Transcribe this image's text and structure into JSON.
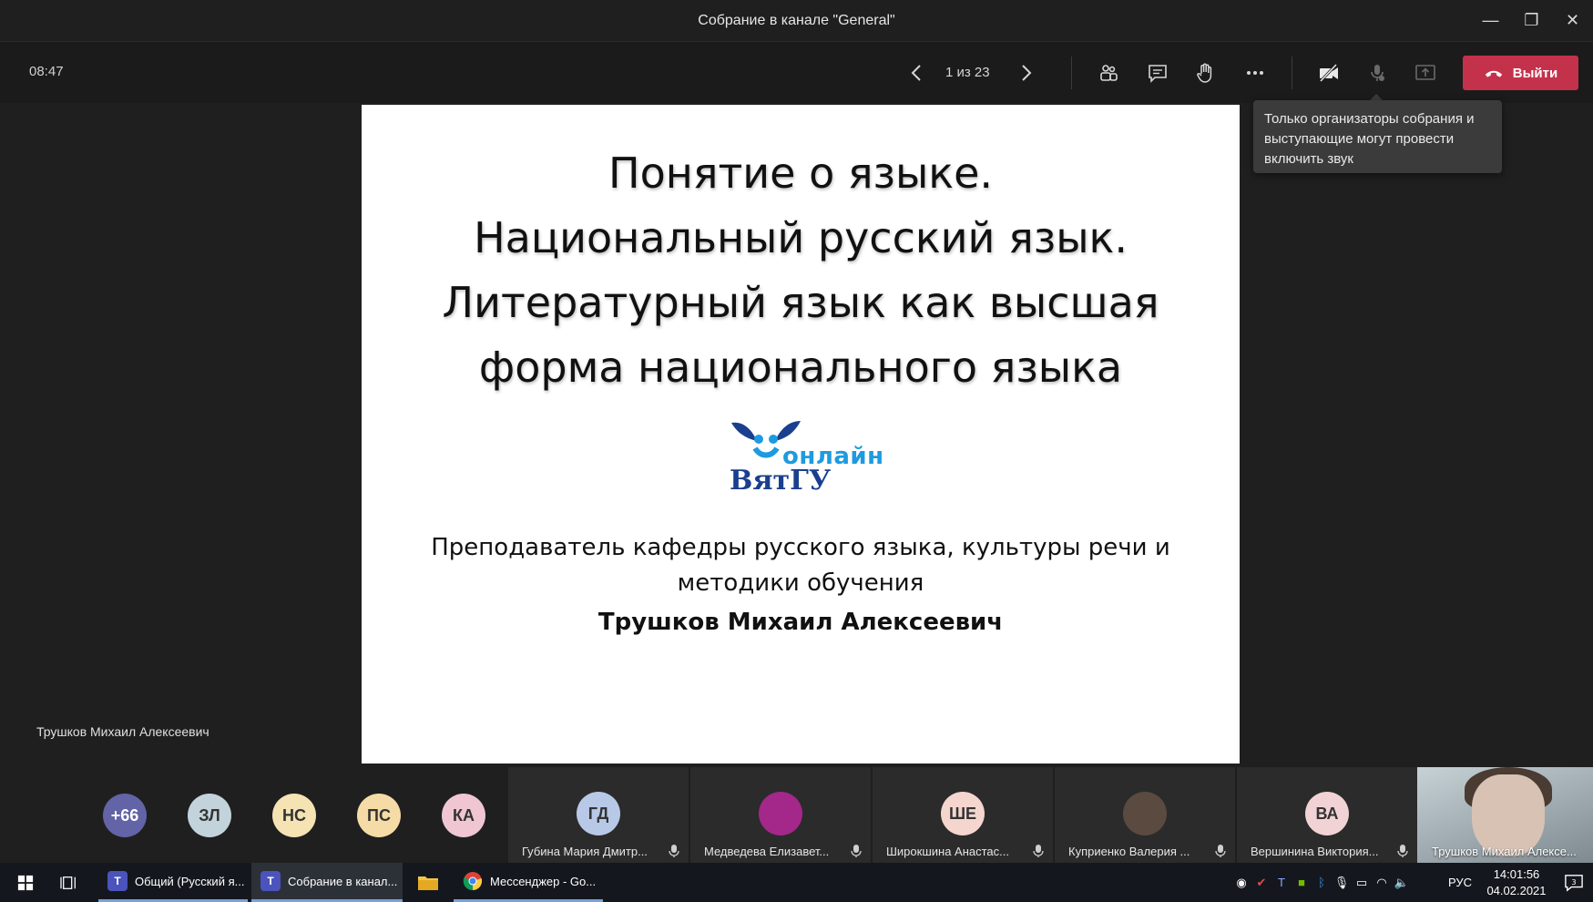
{
  "window": {
    "title": "Собрание в канале \"General\"",
    "controls": {
      "minimize": "—",
      "restore": "❐",
      "close": "✕"
    }
  },
  "toolbar": {
    "timer": "08:47",
    "page_indicator": "1 из 23",
    "leave_label": "Выйти"
  },
  "tooltip": {
    "text": "Только организаторы собрания и выступающие могут провести включить звук"
  },
  "slide": {
    "title_lines": [
      "Понятие о языке.",
      "Национальный русский язык.",
      "Литературный язык как высшая",
      "форма национального языка"
    ],
    "logo_top": "онлайн",
    "logo_bottom": "ВятГУ",
    "subtitle_lines": [
      "Преподаватель кафедры русского языка, культуры речи и",
      "методики обучения"
    ],
    "author": "Трушков Михаил Алексеевич"
  },
  "presenter_label": "Трушков Михаил Алексеевич",
  "participants": {
    "overflow": "+66",
    "small": [
      {
        "initials": "ЗЛ",
        "color": "#c3d3db"
      },
      {
        "initials": "НС",
        "color": "#f5e3b4"
      },
      {
        "initials": "ПС",
        "color": "#f5dca6"
      },
      {
        "initials": "КА",
        "color": "#f0c6d2"
      }
    ],
    "tiles": [
      {
        "initials": "ГД",
        "name": "Губина Мария Дмитр...",
        "color": "#b8c9e8"
      },
      {
        "initials": "",
        "name": "Медведева Елизавет...",
        "color": "#a3288a"
      },
      {
        "initials": "ШЕ",
        "name": "Широкшина Анастас...",
        "color": "#f4d6cf"
      },
      {
        "initials": "",
        "name": "Куприенко Валерия ...",
        "color": "#5a4a40"
      },
      {
        "initials": "ВА",
        "name": "Вершинина Виктория...",
        "color": "#f1d3d6"
      }
    ],
    "video": {
      "name": "Трушков Михаил Алексе..."
    }
  },
  "taskbar": {
    "items": [
      {
        "label": "Общий (Русский я...",
        "state": "open"
      },
      {
        "label": "Собрание в канал...",
        "state": "active"
      },
      {
        "label": "",
        "state": "none"
      },
      {
        "label": "Мессенджер - Go...",
        "state": "open"
      }
    ],
    "language": "РУС",
    "time": "14:01:56",
    "date": "04.02.2021",
    "notifications": "3"
  }
}
